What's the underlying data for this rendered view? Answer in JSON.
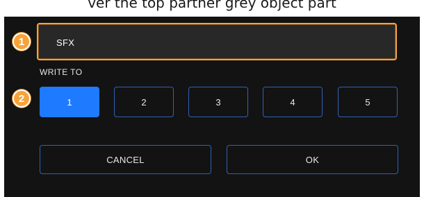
{
  "header": {
    "caption": "ver the top partner grey object part"
  },
  "name_field": {
    "value": "SFX"
  },
  "callouts": {
    "one": "1",
    "two": "2"
  },
  "write_to": {
    "label": "WRITE TO",
    "slots": [
      "1",
      "2",
      "3",
      "4",
      "5"
    ],
    "selected": "1"
  },
  "actions": {
    "cancel_label": "CANCEL",
    "ok_label": "OK"
  },
  "colors": {
    "accent": "#1e7bff",
    "outline": "#2f63b8",
    "highlight": "#f0a54b",
    "callout": "#f6a43a",
    "background": "#131313"
  }
}
